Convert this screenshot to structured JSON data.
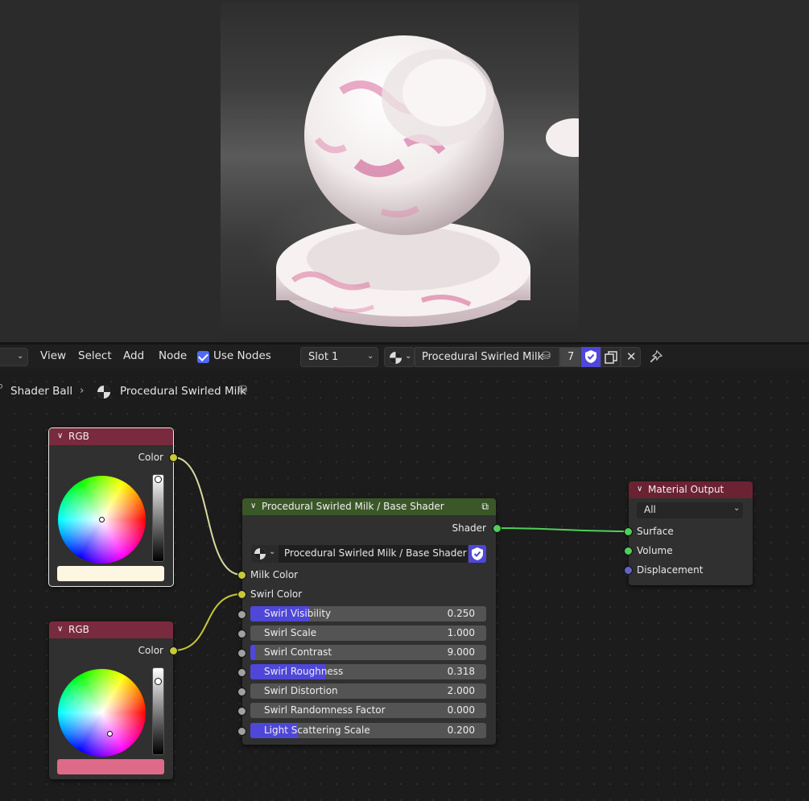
{
  "header": {
    "menu": [
      "View",
      "Select",
      "Add",
      "Node"
    ],
    "use_nodes_label": "Use Nodes",
    "slot": "Slot 1",
    "material_name": "Procedural Swirled Milk",
    "user_count": "7"
  },
  "breadcrumb": {
    "object": "Shader Ball",
    "material": "Procedural Swirled Milk"
  },
  "rgb_node_1": {
    "title": "RGB",
    "output": "Color",
    "swatch_color": "#fdf6e2"
  },
  "rgb_node_2": {
    "title": "RGB",
    "output": "Color",
    "swatch_color": "#de6a8a"
  },
  "group_node": {
    "title": "Procedural Swirled Milk / Base Shader",
    "output": "Shader",
    "datablock": "Procedural Swirled Milk / Base Shader",
    "inputs": [
      "Milk Color",
      "Swirl Color"
    ],
    "fields": [
      {
        "name": "Swirl Visibility",
        "value": "0.250",
        "fill": 0.25
      },
      {
        "name": "Swirl Scale",
        "value": "1.000",
        "fill": 0
      },
      {
        "name": "Swirl Contrast",
        "value": "9.000",
        "fill": 0.02
      },
      {
        "name": "Swirl Roughness",
        "value": "0.318",
        "fill": 0.318
      },
      {
        "name": "Swirl Distortion",
        "value": "2.000",
        "fill": 0
      },
      {
        "name": "Swirl Randomness Factor",
        "value": "0.000",
        "fill": 0
      },
      {
        "name": "Light Scattering Scale",
        "value": "0.200",
        "fill": 0.2
      }
    ]
  },
  "output_node": {
    "title": "Material Output",
    "target": "All",
    "inputs": [
      "Surface",
      "Volume",
      "Displacement"
    ]
  },
  "colors": {
    "rgb_header": "#7a2a3e",
    "group_header": "#3b5728",
    "output_header": "#6b2233",
    "accent": "#4f47d8"
  }
}
